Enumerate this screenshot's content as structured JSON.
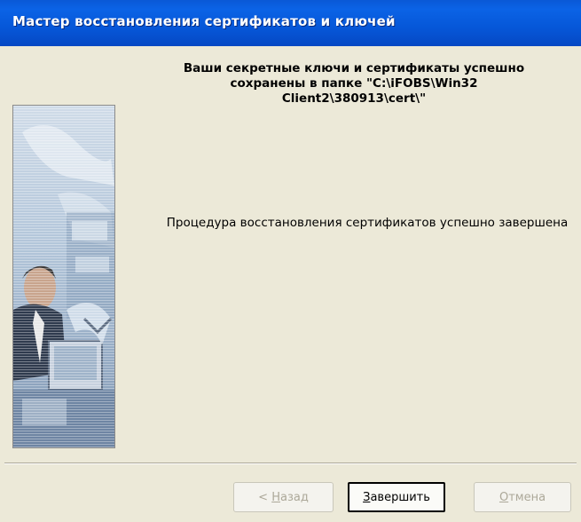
{
  "window": {
    "title": "Мастер восстановления сертификатов и ключей"
  },
  "content": {
    "heading": "Ваши секретные ключи и сертификаты успешно\nсохранены в папке \"C:\\iFOBS\\Win32\nClient2\\380913\\cert\\\"",
    "message": "Процедура восстановления сертификатов успешно завершена"
  },
  "buttons": {
    "back": {
      "prefix": "< ",
      "mnemonic": "Н",
      "rest": "азад"
    },
    "finish": {
      "mnemonic": "З",
      "rest": "авершить"
    },
    "cancel": {
      "mnemonic": "О",
      "rest": "тмена"
    }
  },
  "colors": {
    "titlebar": "#0558d4",
    "dialog_background": "#ece9d8",
    "disabled_text": "#aca899"
  }
}
